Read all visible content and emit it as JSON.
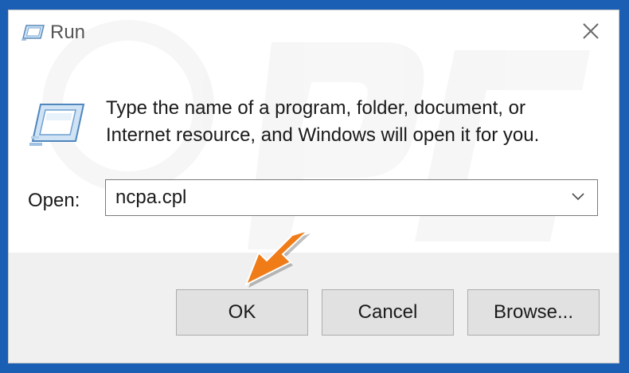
{
  "window": {
    "title": "Run",
    "icon": "run-icon",
    "close_icon": "close-icon"
  },
  "prompt": {
    "line1": "Type the name of a program, folder, document, or",
    "line2": "Internet resource, and Windows will open it for you."
  },
  "open_field": {
    "label": "Open:",
    "value": "ncpa.cpl",
    "dropdown_icon": "chevron-down-icon"
  },
  "buttons": {
    "ok": "OK",
    "cancel": "Cancel",
    "browse": "Browse..."
  },
  "annotation": {
    "arrow_icon": "pointer-arrow-icon",
    "arrow_color": "#f07c18"
  },
  "colors": {
    "background": "#1a5fb4",
    "dialog": "#ffffff",
    "footer": "#f0f0f0",
    "button": "#e1e1e1"
  }
}
